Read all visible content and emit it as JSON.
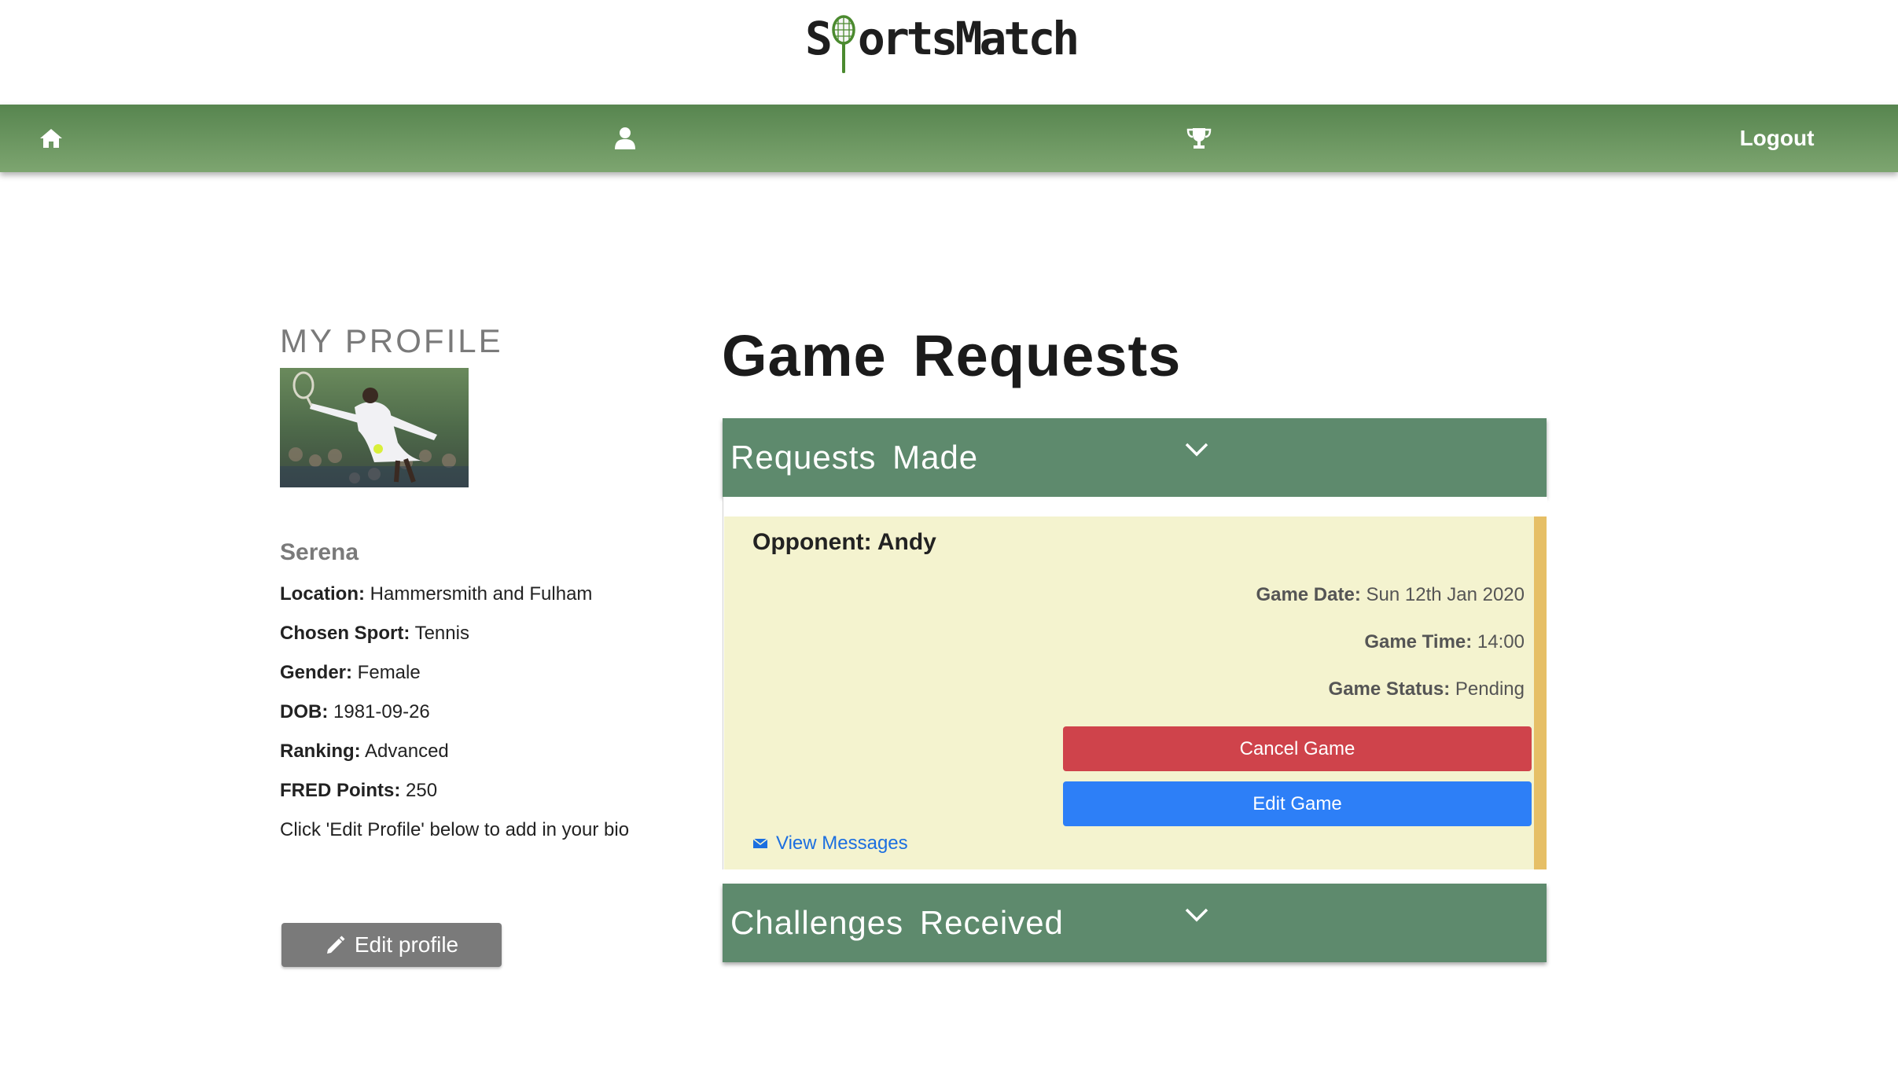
{
  "app": {
    "logo_text_left": "S",
    "logo_text_right": "ortsMatch",
    "brand_color": "#5e8a6d"
  },
  "nav": {
    "home_icon": "home-icon",
    "profile_icon": "user-icon",
    "trophy_icon": "trophy-icon",
    "logout_label": "Logout"
  },
  "profile": {
    "heading": "MY PROFILE",
    "name": "Serena",
    "fields": [
      {
        "label": "Location:",
        "value": " Hammersmith and Fulham"
      },
      {
        "label": "Chosen Sport:",
        "value": " Tennis"
      },
      {
        "label": "Gender:",
        "value": " Female"
      },
      {
        "label": "DOB:",
        "value": " 1981-09-26"
      },
      {
        "label": "Ranking:",
        "value": " Advanced"
      },
      {
        "label": "FRED Points:",
        "value": " 250"
      }
    ],
    "bio_hint": "Click 'Edit Profile' below to add in your bio",
    "edit_button": "Edit profile"
  },
  "requests": {
    "page_title": "Game Requests",
    "made_header": "Requests Made",
    "received_header": "Challenges Received",
    "card": {
      "opponent": "Opponent: Andy",
      "date_label": "Game Date:",
      "date_value": " Sun 12th Jan 2020",
      "time_label": "Game Time:",
      "time_value": " 14:00",
      "status_label": "Game Status:",
      "status_value": " Pending",
      "cancel_button": "Cancel Game",
      "edit_button": "Edit Game",
      "messages_link": "View Messages"
    }
  }
}
